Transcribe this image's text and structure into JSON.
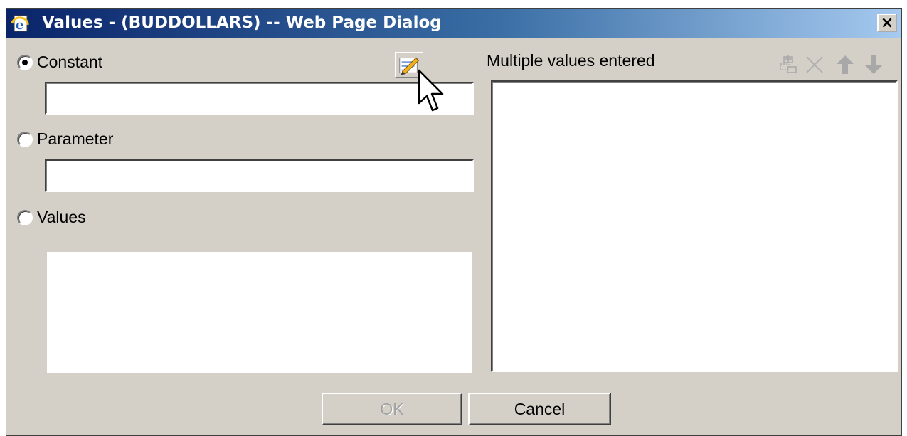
{
  "window": {
    "title": "Values - (BUDDOLLARS) -- Web Page Dialog",
    "close_label": "×"
  },
  "options": {
    "constant": {
      "label": "Constant",
      "checked": true,
      "value": ""
    },
    "parameter": {
      "label": "Parameter",
      "checked": false,
      "value": ""
    },
    "values": {
      "label": "Values",
      "checked": false
    }
  },
  "right_panel": {
    "label": "Multiple values entered",
    "toolbar": [
      "add-icon",
      "delete-icon",
      "move-up-icon",
      "move-down-icon"
    ]
  },
  "buttons": {
    "ok": "OK",
    "cancel": "Cancel"
  },
  "colors": {
    "titlebar_start": "#0a246a",
    "titlebar_end": "#a6caf0",
    "face": "#d4d0c8"
  }
}
